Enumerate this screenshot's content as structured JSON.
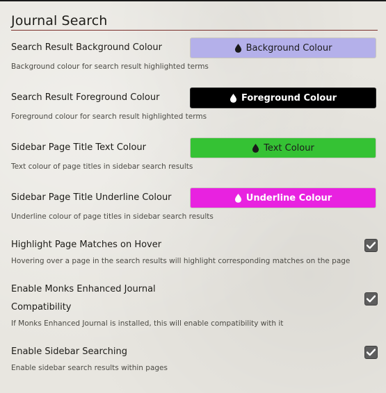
{
  "section": {
    "title": "Journal Search"
  },
  "settings": [
    {
      "label": "Search Result Background Colour",
      "hint": "Background colour for search result highlighted terms",
      "button_label": "Background Colour",
      "button_bg": "#b4b0ea",
      "button_fg": "#1a1a1a",
      "drop_icon": "droplet-icon"
    },
    {
      "label": "Search Result Foreground Colour",
      "hint": "Foreground colour for search result highlighted terms",
      "button_label": "Foreground Colour",
      "button_bg": "#000000",
      "button_fg": "#ffffff",
      "drop_icon": "droplet-icon"
    },
    {
      "label": "Sidebar Page Title Text Colour",
      "hint": "Text colour of page titles in sidebar search results",
      "button_label": "Text Colour",
      "button_bg": "#35c234",
      "button_fg": "#1a1a1a",
      "drop_icon": "droplet-icon"
    },
    {
      "label": "Sidebar Page Title Underline Colour",
      "hint": "Underline colour of page titles in sidebar search results",
      "button_label": "Underline Colour",
      "button_bg": "#e822e0",
      "button_fg": "#ffffff",
      "drop_icon": "droplet-icon"
    },
    {
      "label": "Highlight Page Matches on Hover",
      "hint": "Hovering over a page in the search results will highlight corresponding matches on the page",
      "checked": true
    },
    {
      "label_line1": "Enable Monks Enhanced Journal",
      "label_line2": "Compatibility",
      "hint": "If Monks Enhanced Journal is installed, this will enable compatibility with it",
      "checked": true
    },
    {
      "label": "Enable Sidebar Searching",
      "hint": "Enable sidebar search results within pages",
      "checked": true
    }
  ]
}
